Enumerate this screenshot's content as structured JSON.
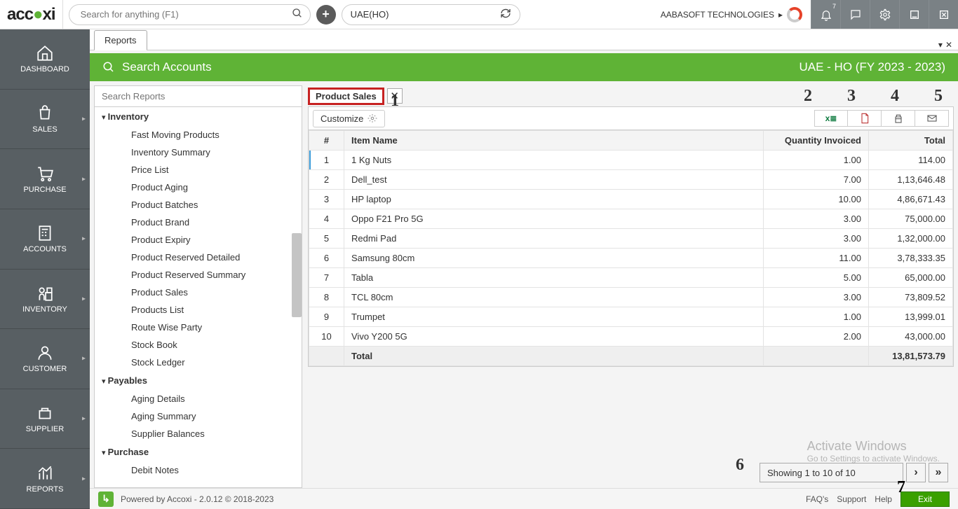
{
  "header": {
    "logo": "accoxi",
    "search_placeholder": "Search for anything (F1)",
    "org": "UAE(HO)",
    "company": "AABASOFT TECHNOLOGIES",
    "notif_count": "7"
  },
  "nav": {
    "dashboard": "DASHBOARD",
    "sales": "SALES",
    "purchase": "PURCHASE",
    "accounts": "ACCOUNTS",
    "inventory": "INVENTORY",
    "customer": "CUSTOMER",
    "supplier": "SUPPLIER",
    "reports": "REPORTS"
  },
  "tabs": {
    "reports": "Reports"
  },
  "greenbar": {
    "search": "Search Accounts",
    "period": "UAE - HO (FY 2023 - 2023)"
  },
  "reports_panel": {
    "search_placeholder": "Search Reports",
    "sections": [
      {
        "title": "Inventory",
        "items": [
          "Fast Moving Products",
          "Inventory Summary",
          "Price List",
          "Product Aging",
          "Product Batches",
          "Product Brand",
          "Product Expiry",
          "Product Reserved Detailed",
          "Product Reserved Summary",
          "Product Sales",
          "Products List",
          "Route Wise Party",
          "Stock Book",
          "Stock Ledger"
        ]
      },
      {
        "title": "Payables",
        "items": [
          "Aging Details",
          "Aging Summary",
          "Supplier Balances"
        ]
      },
      {
        "title": "Purchase",
        "items": [
          "Debit Notes"
        ]
      }
    ]
  },
  "report": {
    "subtab": "Product Sales",
    "customize": "Customize",
    "annots": {
      "a1": "1",
      "a2": "2",
      "a3": "3",
      "a4": "4",
      "a5": "5",
      "a6": "6",
      "a7": "7"
    },
    "columns": {
      "idx": "#",
      "item": "Item Name",
      "qty": "Quantity Invoiced",
      "total": "Total"
    },
    "rows": [
      {
        "idx": "1",
        "item": "1 Kg Nuts",
        "qty": "1.00",
        "total": "114.00"
      },
      {
        "idx": "2",
        "item": "Dell_test",
        "qty": "7.00",
        "total": "1,13,646.48"
      },
      {
        "idx": "3",
        "item": "HP laptop",
        "qty": "10.00",
        "total": "4,86,671.43"
      },
      {
        "idx": "4",
        "item": "Oppo F21 Pro 5G",
        "qty": "3.00",
        "total": "75,000.00"
      },
      {
        "idx": "5",
        "item": "Redmi Pad",
        "qty": "3.00",
        "total": "1,32,000.00"
      },
      {
        "idx": "6",
        "item": "Samsung 80cm",
        "qty": "11.00",
        "total": "3,78,333.35"
      },
      {
        "idx": "7",
        "item": "Tabla",
        "qty": "5.00",
        "total": "65,000.00"
      },
      {
        "idx": "8",
        "item": "TCL 80cm",
        "qty": "3.00",
        "total": "73,809.52"
      },
      {
        "idx": "9",
        "item": "Trumpet",
        "qty": "1.00",
        "total": "13,999.01"
      },
      {
        "idx": "10",
        "item": "Vivo Y200 5G",
        "qty": "2.00",
        "total": "43,000.00"
      }
    ],
    "total_label": "Total",
    "total_value": "13,81,573.79",
    "pager": "Showing 1 to 10 of 10"
  },
  "watermark": {
    "line1": "Activate Windows",
    "line2": "Go to Settings to activate Windows."
  },
  "footer": {
    "powered": "Powered by Accoxi - 2.0.12 © 2018-2023",
    "faqs": "FAQ's",
    "support": "Support",
    "help": "Help",
    "exit": "Exit"
  }
}
